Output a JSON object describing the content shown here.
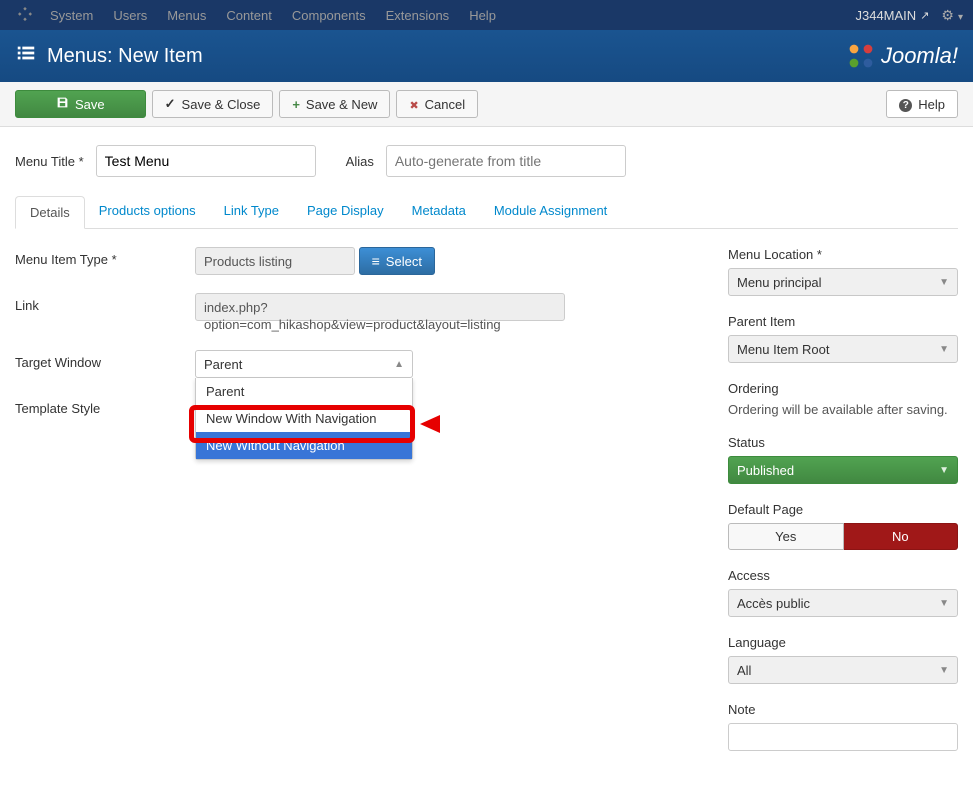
{
  "top_nav": {
    "items": [
      "System",
      "Users",
      "Menus",
      "Content",
      "Components",
      "Extensions",
      "Help"
    ],
    "site_name": "J344MAIN"
  },
  "header": {
    "title": "Menus: New Item",
    "brand": "Joomla!"
  },
  "toolbar": {
    "save": "Save",
    "save_close": "Save & Close",
    "save_new": "Save & New",
    "cancel": "Cancel",
    "help": "Help"
  },
  "form_top": {
    "title_label": "Menu Title *",
    "title_value": "Test Menu",
    "alias_label": "Alias",
    "alias_placeholder": "Auto-generate from title"
  },
  "tabs": [
    "Details",
    "Products options",
    "Link Type",
    "Page Display",
    "Metadata",
    "Module Assignment"
  ],
  "fields": {
    "menu_item_type_label": "Menu Item Type *",
    "menu_item_type_value": "Products listing",
    "select_label": "Select",
    "link_label": "Link",
    "link_value": "index.php?option=com_hikashop&view=product&layout=listing",
    "target_window_label": "Target Window",
    "target_window_value": "Parent",
    "target_window_options": [
      "Parent",
      "New Window With Navigation",
      "New Without Navigation"
    ],
    "template_style_label": "Template Style"
  },
  "sidebar": {
    "menu_location_label": "Menu Location *",
    "menu_location_value": "Menu principal",
    "parent_item_label": "Parent Item",
    "parent_item_value": "Menu Item Root",
    "ordering_label": "Ordering",
    "ordering_text": "Ordering will be available after saving.",
    "status_label": "Status",
    "status_value": "Published",
    "default_page_label": "Default Page",
    "default_page_yes": "Yes",
    "default_page_no": "No",
    "access_label": "Access",
    "access_value": "Accès public",
    "language_label": "Language",
    "language_value": "All",
    "note_label": "Note"
  }
}
